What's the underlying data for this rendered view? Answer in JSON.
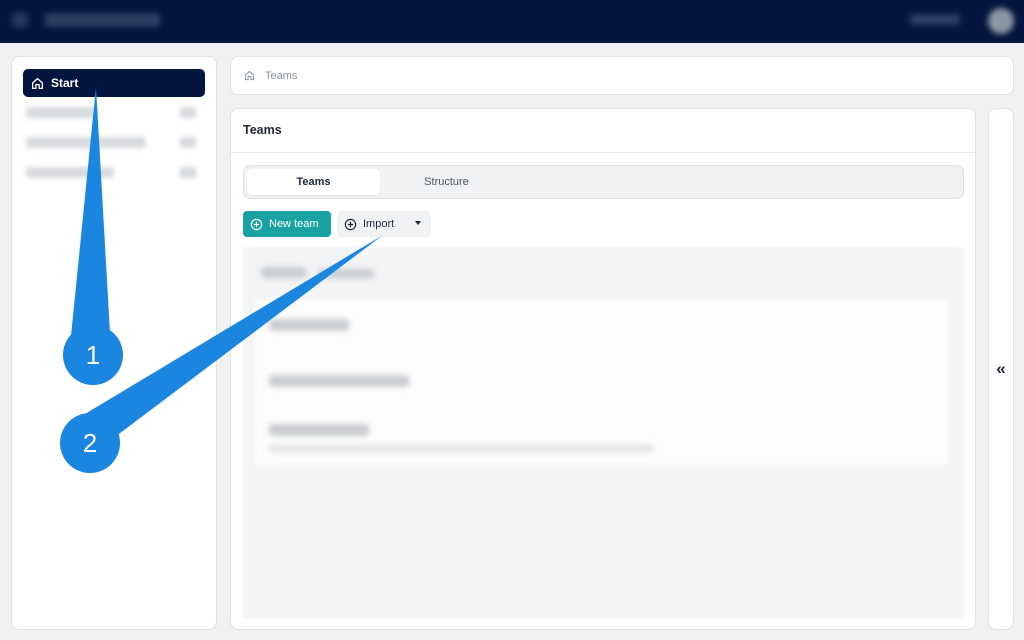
{
  "sidebar": {
    "start_label": "Start"
  },
  "breadcrumb": {
    "current": "Teams"
  },
  "main": {
    "title": "Teams",
    "tabs": [
      {
        "label": "Teams",
        "active": true
      },
      {
        "label": "Structure",
        "active": false
      }
    ],
    "new_team_label": "New team",
    "import_label": "Import"
  },
  "collapse_glyph": "«",
  "callouts": [
    {
      "number": "1"
    },
    {
      "number": "2"
    }
  ],
  "colors": {
    "topbar": "#04163f",
    "accent_teal": "#1aa1a1",
    "callout_blue": "#1b86e0"
  },
  "icons": [
    "menu-icon",
    "home-icon",
    "plus-circle-icon",
    "caret-down-icon",
    "double-chevron-left-icon"
  ]
}
